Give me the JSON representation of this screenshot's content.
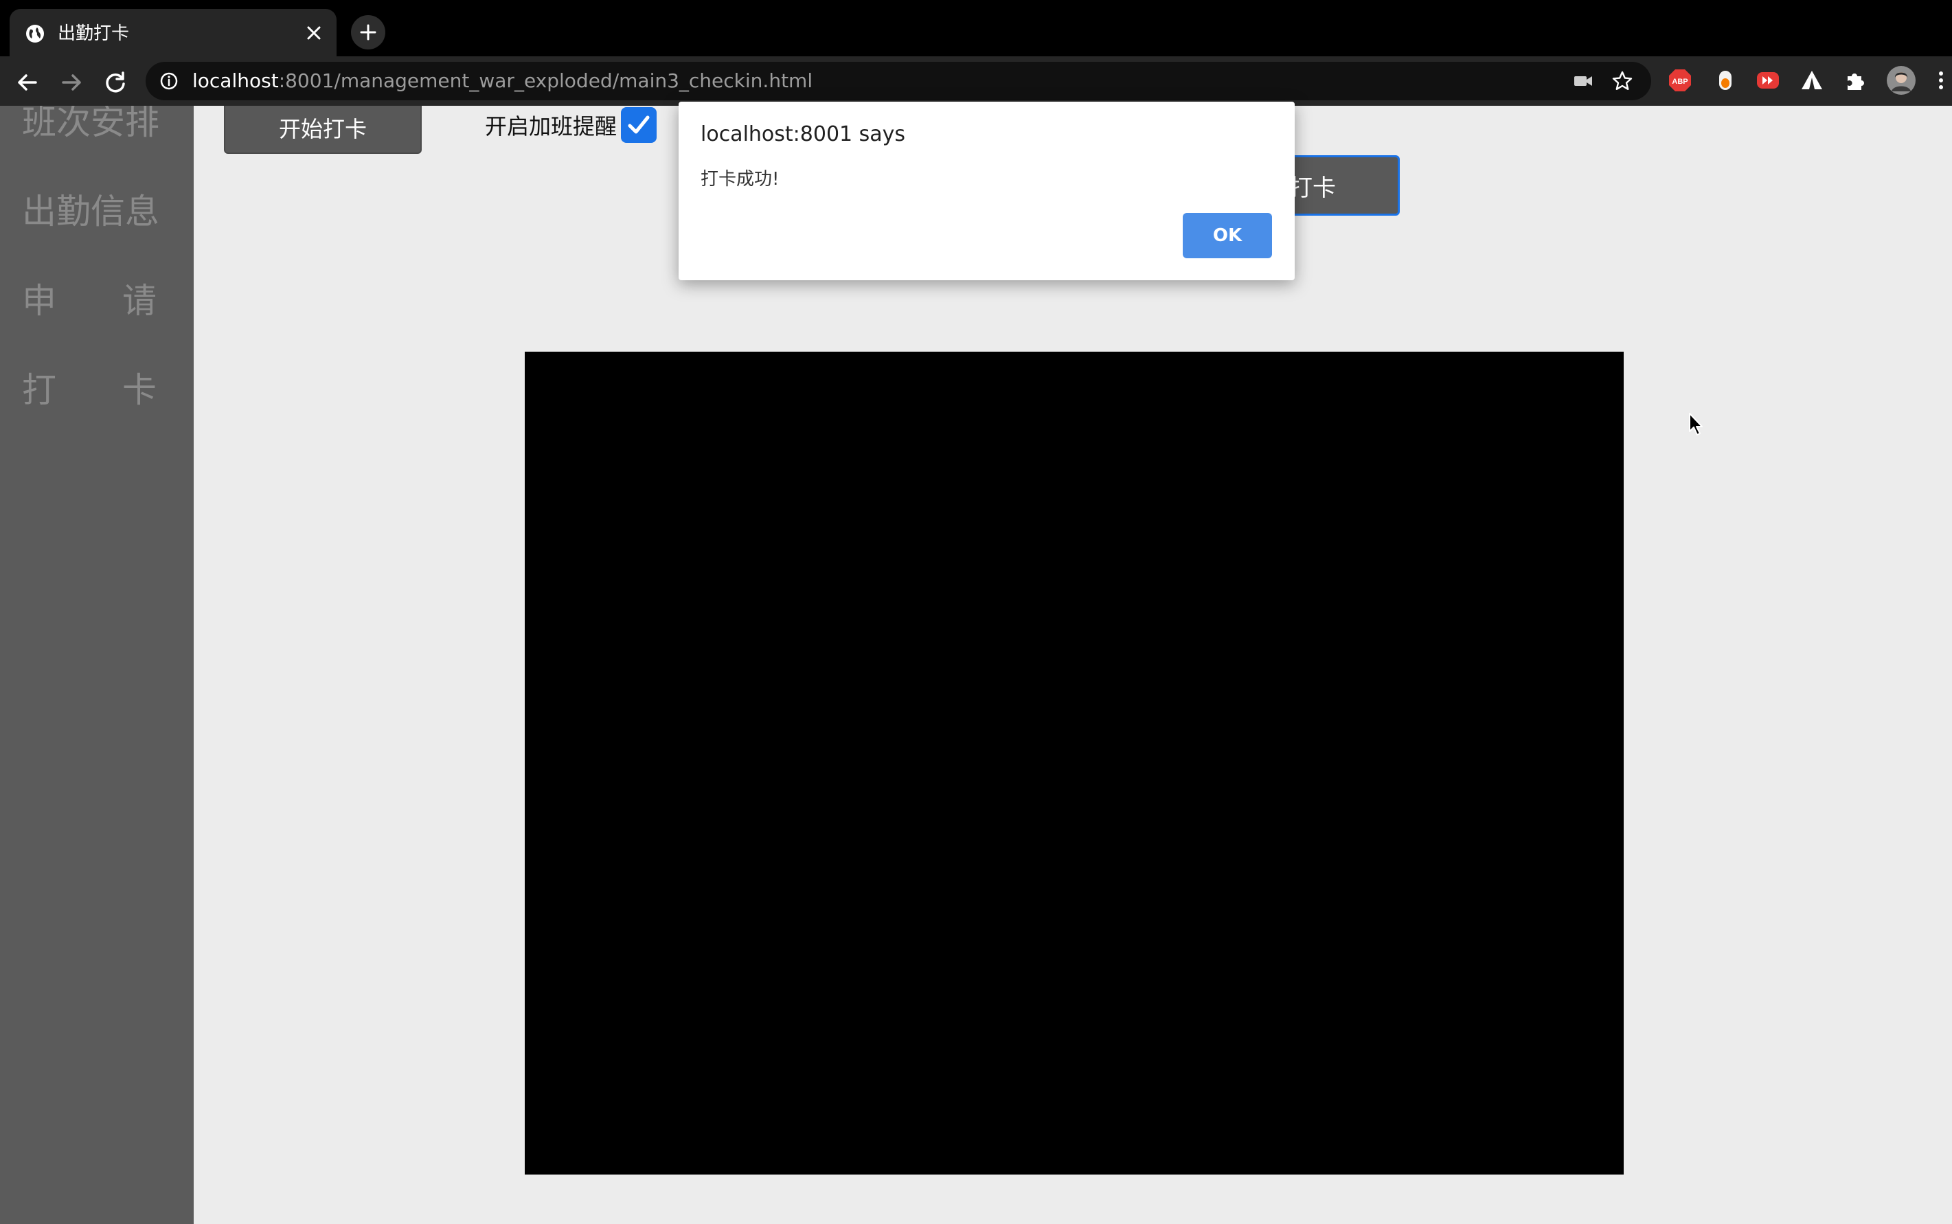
{
  "browser": {
    "tab_title": "出勤打卡",
    "url_host": "localhost",
    "url_rest": ":8001/management_war_exploded/main3_checkin.html",
    "extensions": [
      "ABP",
      "extension",
      "extension",
      "extension",
      "extensions",
      "profile"
    ]
  },
  "sidebar": {
    "items": [
      {
        "label": "班次安排"
      },
      {
        "label": "出勤信息"
      },
      {
        "label_left": "申",
        "label_right": "请"
      },
      {
        "label_left": "打",
        "label_right": "卡"
      }
    ]
  },
  "main": {
    "start_button": "开始打卡",
    "overtime_label": "开启加班提醒",
    "overtime_checked": true,
    "checkin_button": "拍照打卡"
  },
  "dialog": {
    "title": "localhost:8001 says",
    "message": "打卡成功!",
    "ok_label": "OK"
  },
  "colors": {
    "sidebar_bg": "#5b5b5b",
    "page_bg": "#ececec",
    "accent": "#1a73e8",
    "ok_button": "#4a8ee8"
  }
}
